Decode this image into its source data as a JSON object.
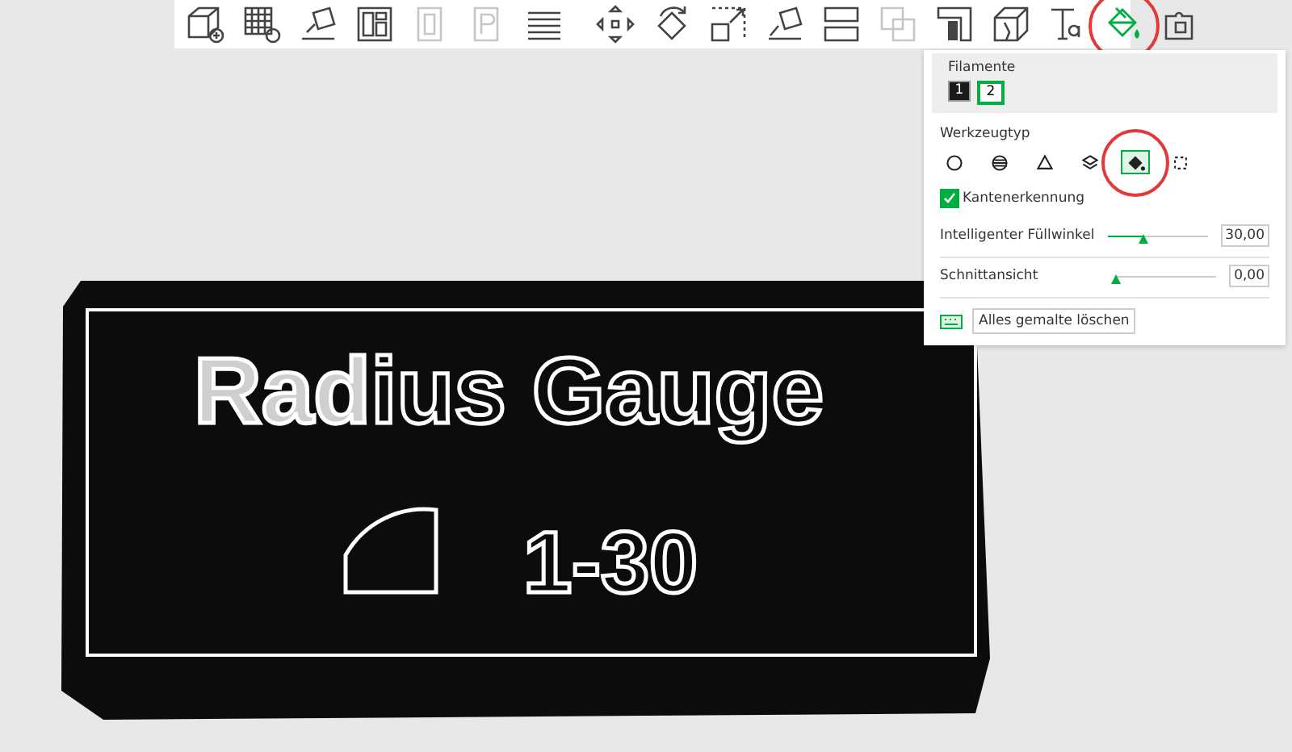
{
  "toolbar": {
    "tools": [
      {
        "kind": "add-cube",
        "disabled": false,
        "selected": false,
        "highlighted": false
      },
      {
        "kind": "add-grid",
        "disabled": false,
        "selected": false,
        "highlighted": false
      },
      {
        "kind": "auto-orient",
        "disabled": false,
        "selected": false,
        "highlighted": false
      },
      {
        "kind": "arrange",
        "disabled": false,
        "selected": false,
        "highlighted": false
      },
      {
        "kind": "plate-zero",
        "disabled": true,
        "selected": false,
        "highlighted": false
      },
      {
        "kind": "plate-p",
        "disabled": true,
        "selected": false,
        "highlighted": false
      },
      {
        "kind": "layers",
        "disabled": false,
        "selected": false,
        "highlighted": false
      },
      {
        "kind": "move",
        "disabled": false,
        "selected": false,
        "highlighted": false
      },
      {
        "kind": "rotate",
        "disabled": false,
        "selected": false,
        "highlighted": false
      },
      {
        "kind": "scale",
        "disabled": false,
        "selected": false,
        "highlighted": false
      },
      {
        "kind": "lay-flat",
        "disabled": false,
        "selected": false,
        "highlighted": false
      },
      {
        "kind": "split",
        "disabled": false,
        "selected": false,
        "highlighted": false
      },
      {
        "kind": "boolean",
        "disabled": true,
        "selected": false,
        "highlighted": false
      },
      {
        "kind": "support",
        "disabled": false,
        "selected": false,
        "highlighted": false
      },
      {
        "kind": "cut",
        "disabled": false,
        "selected": false,
        "highlighted": false
      },
      {
        "kind": "text",
        "disabled": false,
        "selected": false,
        "highlighted": false
      },
      {
        "kind": "paint",
        "disabled": false,
        "selected": true,
        "highlighted": true
      },
      {
        "kind": "assembly",
        "disabled": false,
        "selected": false,
        "highlighted": false
      }
    ]
  },
  "panel": {
    "filaments_label": "Filamente",
    "filaments": [
      {
        "label": "1",
        "color": "#1a1a1a",
        "selected": false
      },
      {
        "label": "2",
        "color": "#ffffff",
        "selected": true
      }
    ],
    "tool_type_label": "Werkzeugtyp",
    "tool_types": [
      {
        "kind": "circle",
        "selected": false,
        "highlighted": false
      },
      {
        "kind": "sphere",
        "selected": false,
        "highlighted": false
      },
      {
        "kind": "triangle",
        "selected": false,
        "highlighted": false
      },
      {
        "kind": "height-range",
        "selected": false,
        "highlighted": false
      },
      {
        "kind": "fill",
        "selected": true,
        "highlighted": true
      },
      {
        "kind": "gap-fill",
        "selected": false,
        "highlighted": false
      }
    ],
    "edge_detection": {
      "label": "Kantenerkennung",
      "checked": true
    },
    "sliders": [
      {
        "label": "Intelligenter Füllwinkel",
        "level": 0.36,
        "reading": "30,00"
      },
      {
        "label": "Schnittansicht",
        "level": 0.0,
        "reading": "0,00"
      }
    ],
    "clear_button": "Alles gemalte löschen"
  },
  "model": {
    "title_painted": "Rad",
    "title_rest": "ius Gauge",
    "range": "1-30"
  }
}
